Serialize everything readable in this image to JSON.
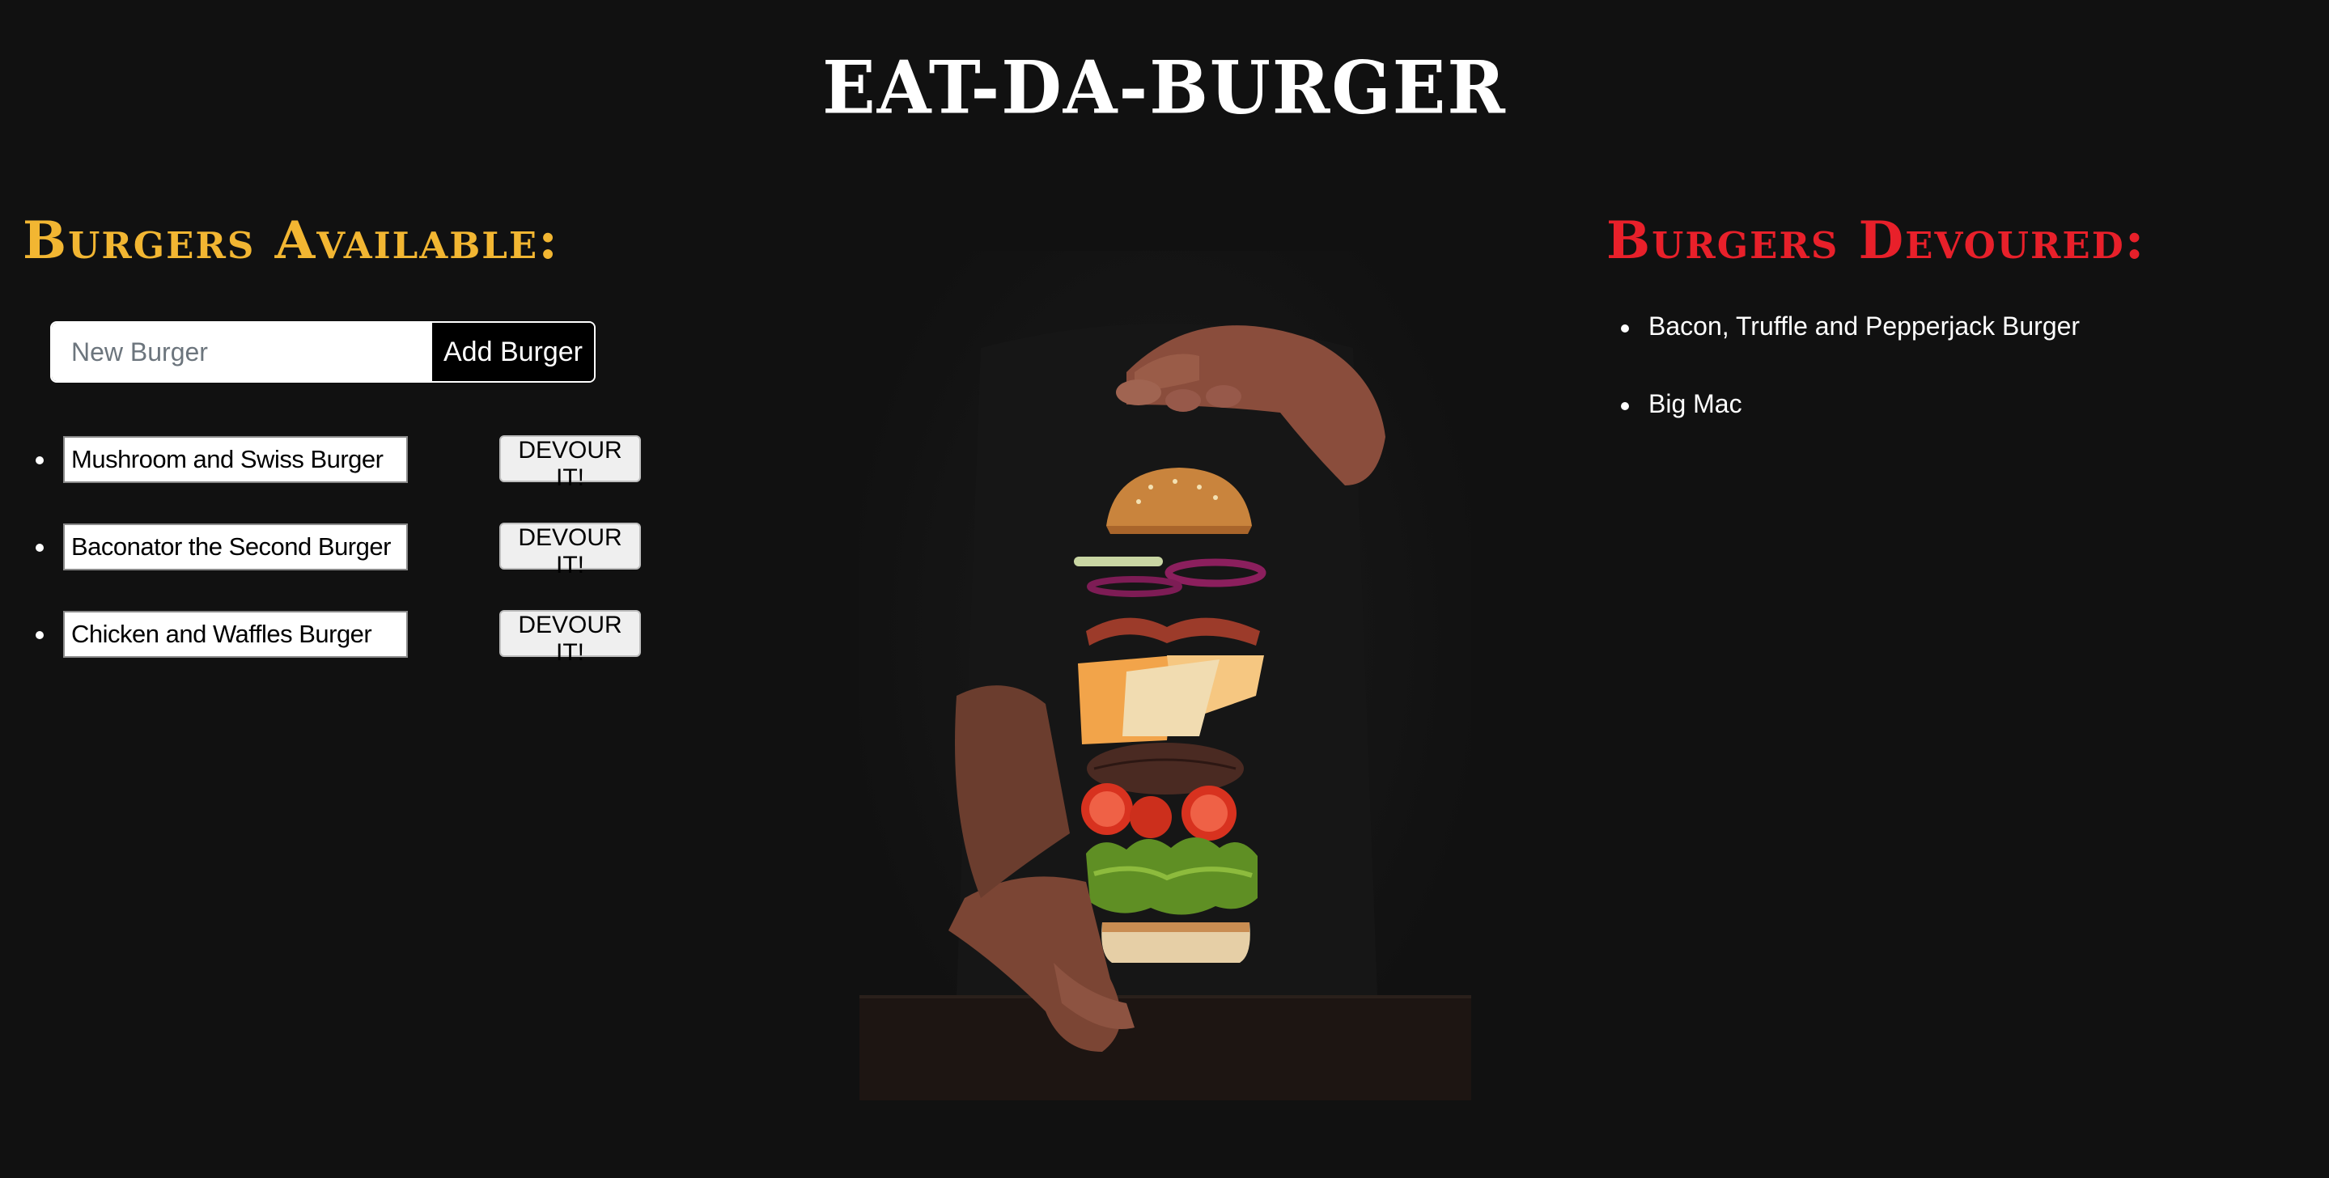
{
  "app": {
    "title": "EAT-DA-BURGER"
  },
  "available": {
    "heading": "Burgers Available:",
    "heading_color": "#f2b632",
    "input_placeholder": "New Burger",
    "add_button_label": "Add Burger",
    "devour_button_label": "DEVOUR IT!",
    "items": [
      {
        "name": "Mushroom and Swiss Burger"
      },
      {
        "name": "Baconator the Second Burger"
      },
      {
        "name": "Chicken and Waffles Burger"
      }
    ]
  },
  "devoured": {
    "heading": "Burgers Devoured:",
    "heading_color": "#e8202a",
    "items": [
      {
        "name": "Bacon, Truffle and Pepperjack Burger"
      },
      {
        "name": "Big Mac"
      }
    ]
  },
  "hero": {
    "icon": "floating-burger-image"
  }
}
